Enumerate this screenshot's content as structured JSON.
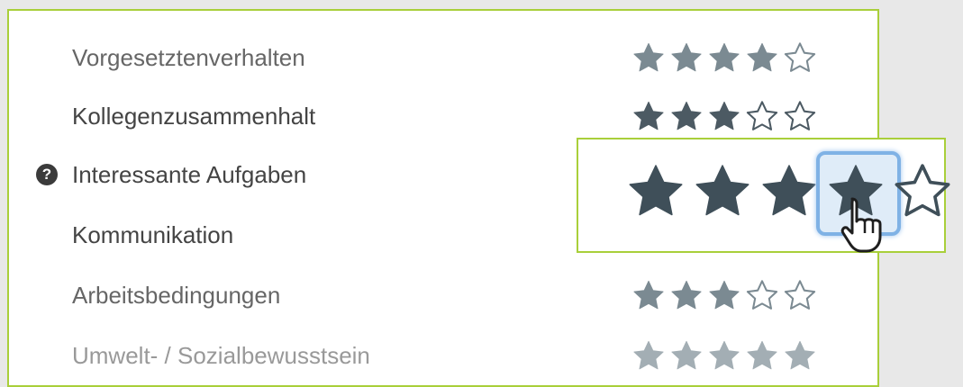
{
  "ratings": [
    {
      "label": "Vorgesetztenverhalten",
      "stars": 4,
      "tone": "#7b8a92"
    },
    {
      "label": "Kollegenzusammenhalt",
      "stars": 3,
      "tone": "#4c5a63"
    },
    {
      "label": "Interessante Aufgaben",
      "stars": null,
      "tone": "#4c5a63",
      "help": "?"
    },
    {
      "label": "Kommunikation",
      "stars": null,
      "tone": "#4c5a63"
    },
    {
      "label": "Arbeitsbedingungen",
      "stars": 3,
      "tone": "#7b8a92"
    },
    {
      "label": "Umwelt- / Sozialbewusstsein",
      "stars": 5,
      "tone": "#a3aeb4"
    }
  ],
  "zoom": {
    "hovered_star": 4,
    "filled": 4,
    "max": 5,
    "tone": "#3f4f59",
    "highlight": "#7fb2e5"
  },
  "colors": {
    "accent_border": "#a9cf3a",
    "background": "#e8e8e8"
  }
}
